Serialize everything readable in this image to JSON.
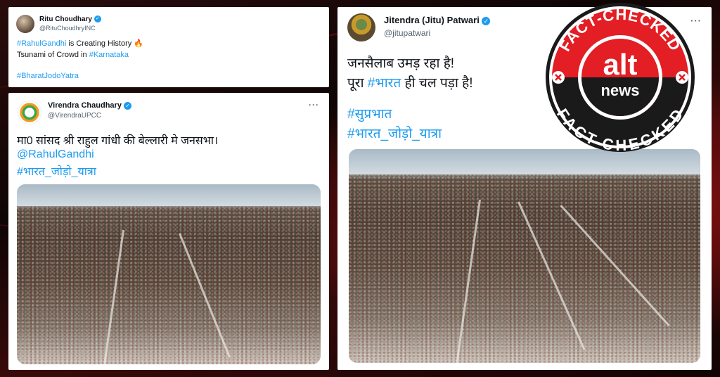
{
  "tweet1": {
    "name": "Ritu Choudhary",
    "handle": "@RituChoudhryINC",
    "tag1": "#RahulGandhi",
    "line1_rest": " is Creating History 🔥",
    "line2_text": "Tsunami of Crowd in ",
    "tag2": "#Karnataka",
    "tag3": "#BharatJodoYatra"
  },
  "tweet2": {
    "name": "Virendra Chaudhary",
    "handle": "@VirendraUPCC",
    "more": "···",
    "line1": "मा0 सांसद श्री राहुल गांधी की बेल्लारी मे जनसभा।",
    "mention": "@RahulGandhi",
    "tag": "#भारत_जोड़ो_यात्रा"
  },
  "tweet3": {
    "name": "Jitendra (Jitu) Patwari",
    "handle": "@jitupatwari",
    "more": "···",
    "line1": "जनसैलाब उमड़ रहा है!",
    "line2_pre": "पूरा ",
    "line2_tag": "#भारत",
    "line2_post": " ही चल पड़ा है!",
    "tag1": "#सुप्रभात",
    "tag2": "#भारत_जोड़ो_यात्रा"
  },
  "stamp": {
    "top_text": "FACT-CHECKED",
    "bottom_text": "FACT-CHECKED",
    "logo_top": "alt",
    "logo_bottom": "news",
    "red": "#e31e24",
    "dark": "#1a1a1a"
  },
  "colors": {
    "link": "#1d9bf0",
    "verified": "#1d9bf0",
    "text": "#0f1419",
    "muted": "#536471"
  }
}
